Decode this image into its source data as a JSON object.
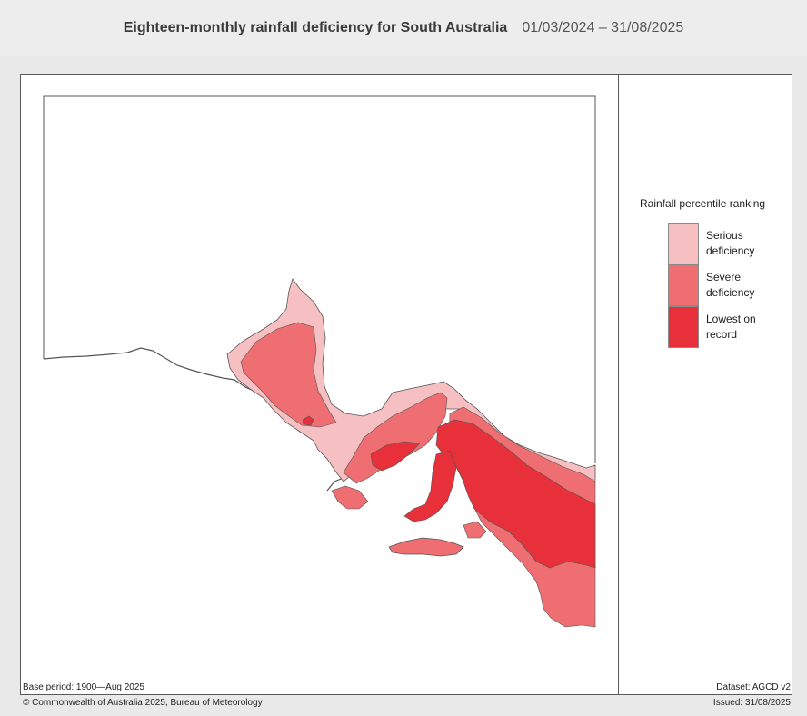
{
  "header": {
    "title": "Eighteen-monthly rainfall deficiency for South Australia",
    "period": "01/03/2024 – 31/08/2025"
  },
  "legend": {
    "title": "Rainfall percentile ranking",
    "items": [
      {
        "label": "Serious deficiency",
        "color": "#f6c0c2"
      },
      {
        "label": "Severe deficiency",
        "color": "#ee6e72"
      },
      {
        "label": "Lowest on record",
        "color": "#e7303a"
      }
    ]
  },
  "footer": {
    "base_period": "Base period: 1900—Aug 2025",
    "dataset": "Dataset: AGCD v2",
    "copyright": "© Commonwealth of Australia 2025, Bureau of Meteorology",
    "issued": "Issued: 31/08/2025"
  },
  "colors": {
    "serious": "#f6c0c2",
    "severe": "#ee6e72",
    "lowest": "#e7303a",
    "coast": "#555555"
  }
}
